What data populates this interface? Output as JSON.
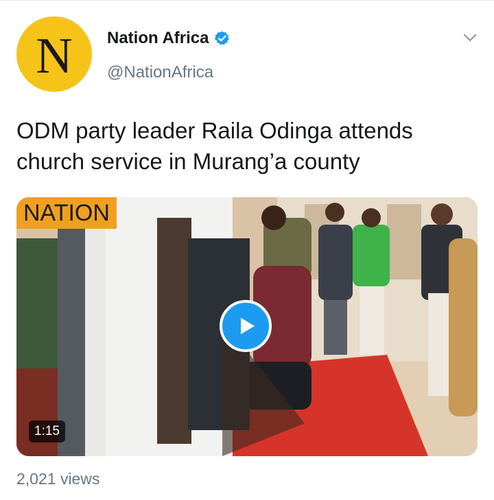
{
  "tweet": {
    "avatar": {
      "letter": "N",
      "color": "#f6c319"
    },
    "author": {
      "display_name": "Nation Africa",
      "handle": "@NationAfrica",
      "verified": true,
      "verified_icon": "verified-badge-icon"
    },
    "menu_icon": "chevron-down-icon",
    "text": "ODM party leader Raila Odinga attends church service in Murang’a county",
    "media": {
      "type": "video",
      "watermark": "NATION",
      "duration": "1:15",
      "play_icon": "play-icon"
    },
    "views": "2,021 views"
  },
  "colors": {
    "accent": "#1d9bf0",
    "muted_text": "#657786",
    "watermark_bg": "#f0a020"
  }
}
